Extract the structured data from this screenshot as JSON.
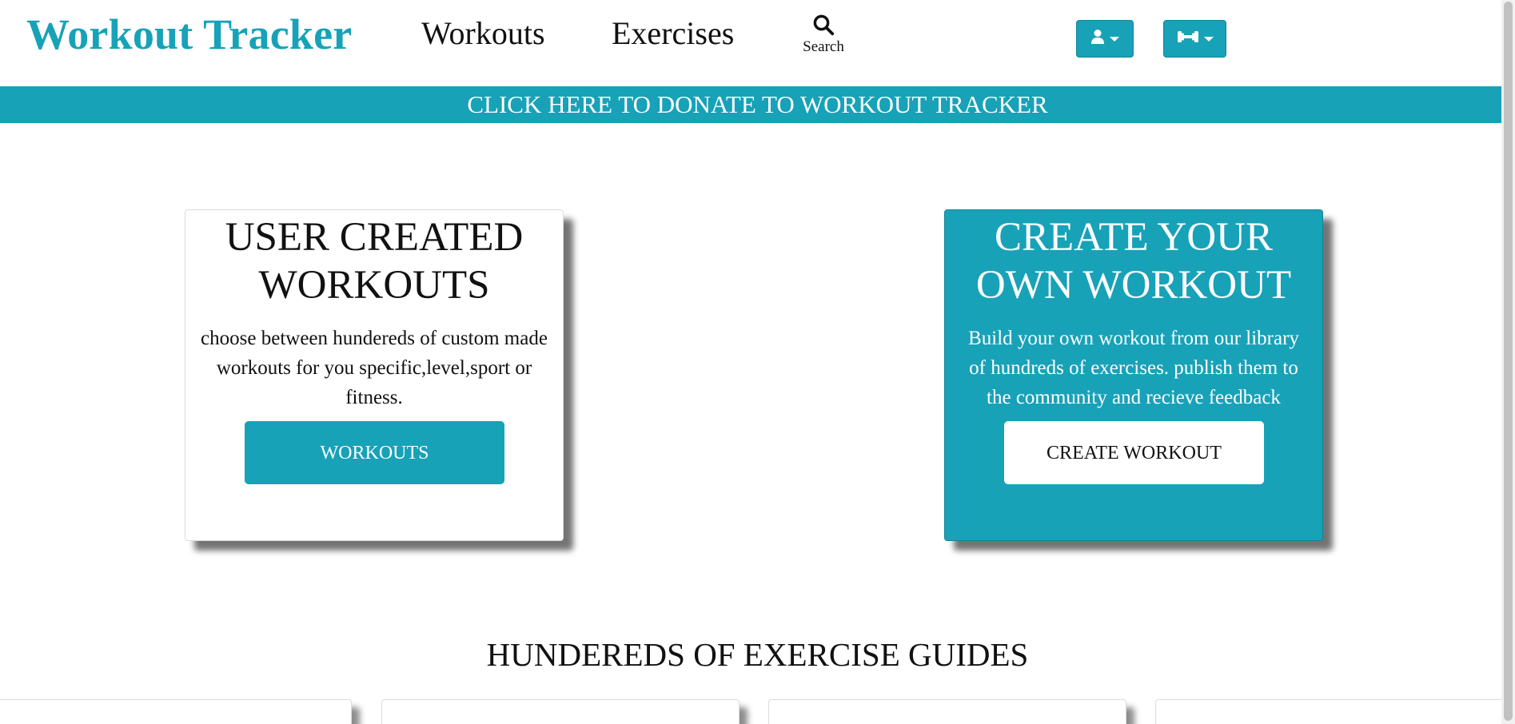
{
  "navbar": {
    "brand": "Workout Tracker",
    "links": [
      "Workouts",
      "Exercises"
    ],
    "search_label": "Search",
    "icons": {
      "search": "search-icon",
      "user": "user-icon",
      "gym": "dumbbell-icon"
    }
  },
  "banner": {
    "text": "CLICK HERE TO DONATE TO WORKOUT TRACKER"
  },
  "cards": [
    {
      "title": "USER CREATED WORKOUTS",
      "text": "choose between hundereds of custom made workouts for you specific,level,sport or fitness.",
      "button": "WORKOUTS"
    },
    {
      "title": "CREATE YOUR OWN WORKOUT",
      "text": "Build your own workout from our library of hundreds of exercises. publish them to the community and recieve feedback",
      "button": "CREATE WORKOUT"
    }
  ],
  "section": {
    "title": "HUNDEREDS OF EXERCISE GUIDES"
  },
  "colors": {
    "accent": "#17a2b8",
    "text": "#111111",
    "background": "#ffffff"
  }
}
